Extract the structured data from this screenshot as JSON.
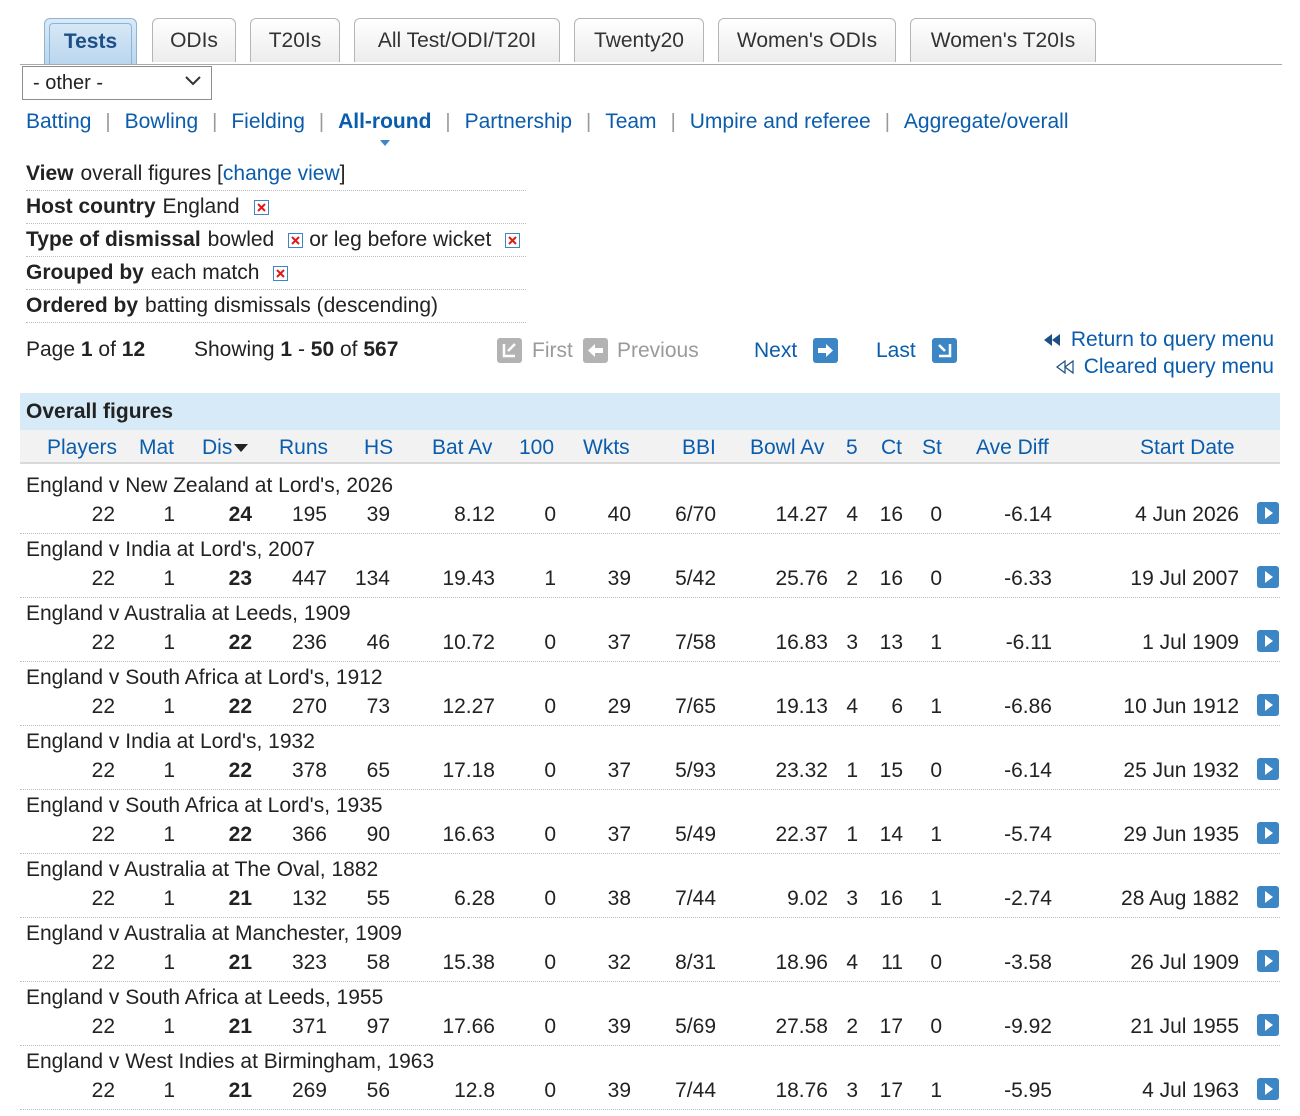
{
  "tabs": [
    "Tests",
    "ODIs",
    "T20Is",
    "All Test/ODI/T20I",
    "Twenty20",
    "Women's ODIs",
    "Women's T20Is"
  ],
  "select": {
    "value": "- other -"
  },
  "nav": [
    "Batting",
    "Bowling",
    "Fielding",
    "All-round",
    "Partnership",
    "Team",
    "Umpire and referee",
    "Aggregate/overall"
  ],
  "filters": {
    "view_label": "View",
    "view_text": "overall figures [",
    "view_link": "change view",
    "view_close": "]",
    "host_label": "Host country",
    "host_value": "England",
    "dismissal_label": "Type of dismissal",
    "dismissal_value1": "bowled",
    "dismissal_or": "or leg before wicket",
    "grouped_label": "Grouped by",
    "grouped_value": "each match",
    "ordered_label": "Ordered by",
    "ordered_value": "batting dismissals (descending)"
  },
  "paging": {
    "page_word": "Page",
    "page": "1",
    "of_word": "of",
    "pages": "12",
    "showing_word": "Showing",
    "from": "1",
    "dash": "-",
    "to": "50",
    "total": "567",
    "first": "First",
    "previous": "Previous",
    "next": "Next",
    "last": "Last",
    "return_query": "Return to query menu",
    "cleared_query": "Cleared query menu"
  },
  "table": {
    "caption": "Overall figures",
    "headers": [
      "Players",
      "Mat",
      "Dis",
      "Runs",
      "HS",
      "Bat Av",
      "100",
      "Wkts",
      "BBI",
      "Bowl Av",
      "5",
      "Ct",
      "St",
      "Ave Diff",
      "Start Date"
    ],
    "rows": [
      {
        "match": "England v New Zealand at Lord's, 2026",
        "cells": [
          "22",
          "1",
          "24",
          "195",
          "39",
          "8.12",
          "0",
          "40",
          "6/70",
          "14.27",
          "4",
          "16",
          "0",
          "-6.14",
          "4 Jun 2026"
        ]
      },
      {
        "match": "England v India at Lord's, 2007",
        "cells": [
          "22",
          "1",
          "23",
          "447",
          "134",
          "19.43",
          "1",
          "39",
          "5/42",
          "25.76",
          "2",
          "16",
          "0",
          "-6.33",
          "19 Jul 2007"
        ]
      },
      {
        "match": "England v Australia at Leeds, 1909",
        "cells": [
          "22",
          "1",
          "22",
          "236",
          "46",
          "10.72",
          "0",
          "37",
          "7/58",
          "16.83",
          "3",
          "13",
          "1",
          "-6.11",
          "1 Jul 1909"
        ]
      },
      {
        "match": "England v South Africa at Lord's, 1912",
        "cells": [
          "22",
          "1",
          "22",
          "270",
          "73",
          "12.27",
          "0",
          "29",
          "7/65",
          "19.13",
          "4",
          "6",
          "1",
          "-6.86",
          "10 Jun 1912"
        ]
      },
      {
        "match": "England v India at Lord's, 1932",
        "cells": [
          "22",
          "1",
          "22",
          "378",
          "65",
          "17.18",
          "0",
          "37",
          "5/93",
          "23.32",
          "1",
          "15",
          "0",
          "-6.14",
          "25 Jun 1932"
        ]
      },
      {
        "match": "England v South Africa at Lord's, 1935",
        "cells": [
          "22",
          "1",
          "22",
          "366",
          "90",
          "16.63",
          "0",
          "37",
          "5/49",
          "22.37",
          "1",
          "14",
          "1",
          "-5.74",
          "29 Jun 1935"
        ]
      },
      {
        "match": "England v Australia at The Oval, 1882",
        "cells": [
          "22",
          "1",
          "21",
          "132",
          "55",
          "6.28",
          "0",
          "38",
          "7/44",
          "9.02",
          "3",
          "16",
          "1",
          "-2.74",
          "28 Aug 1882"
        ]
      },
      {
        "match": "England v Australia at Manchester, 1909",
        "cells": [
          "22",
          "1",
          "21",
          "323",
          "58",
          "15.38",
          "0",
          "32",
          "8/31",
          "18.96",
          "4",
          "11",
          "0",
          "-3.58",
          "26 Jul 1909"
        ]
      },
      {
        "match": "England v South Africa at Leeds, 1955",
        "cells": [
          "22",
          "1",
          "21",
          "371",
          "97",
          "17.66",
          "0",
          "39",
          "5/69",
          "27.58",
          "2",
          "17",
          "0",
          "-9.92",
          "21 Jul 1955"
        ]
      },
      {
        "match": "England v West Indies at Birmingham, 1963",
        "cells": [
          "22",
          "1",
          "21",
          "269",
          "56",
          "12.8",
          "0",
          "39",
          "7/44",
          "18.76",
          "3",
          "17",
          "1",
          "-5.95",
          "4 Jul 1963"
        ]
      }
    ]
  },
  "colors": {
    "link": "#0a5cad",
    "caption_bg": "#d6eaf8",
    "active_tab": "#bad6ee",
    "icon_blue": "#3d86c6",
    "icon_gray": "#b3b3b3"
  }
}
